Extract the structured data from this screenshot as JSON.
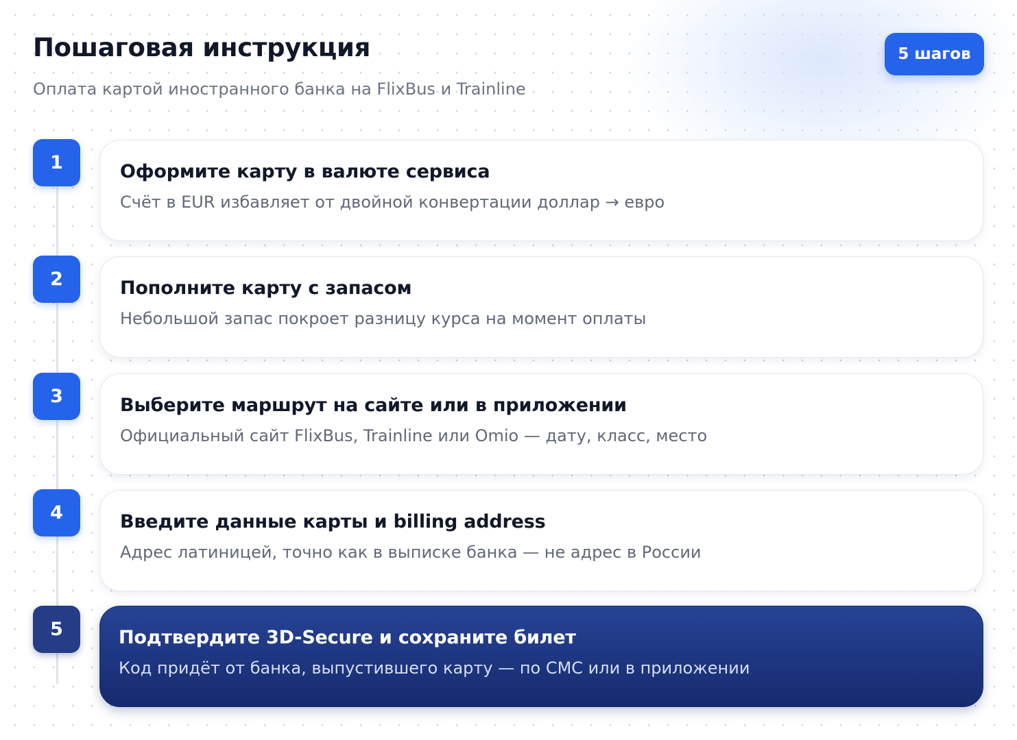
{
  "header": {
    "title": "Пошаговая инструкция",
    "subtitle": "Оплата картой иностранного банка на FlixBus и Trainline",
    "badge": "5 шагов"
  },
  "colors": {
    "accent": "#2563eb",
    "final_step": "#1c327a",
    "title_text": "#12182a",
    "muted_text": "#616878"
  },
  "steps": [
    {
      "number": "1",
      "title": "Оформите карту в валюте сервиса",
      "description": "Счёт в EUR избавляет от двойной конвертации доллар → евро"
    },
    {
      "number": "2",
      "title": "Пополните карту с запасом",
      "description": "Небольшой запас покроет разницу курса на момент оплаты"
    },
    {
      "number": "3",
      "title": "Выберите маршрут на сайте или в приложении",
      "description": "Официальный сайт FlixBus, Trainline или Omio — дату, класс, место"
    },
    {
      "number": "4",
      "title": "Введите данные карты и billing address",
      "description": "Адрес латиницей, точно как в выписке банка — не адрес в России"
    },
    {
      "number": "5",
      "title": "Подтвердите 3D-Secure и сохраните билет",
      "description": "Код придёт от банка, выпустившего карту — по СМС или в приложении"
    }
  ]
}
